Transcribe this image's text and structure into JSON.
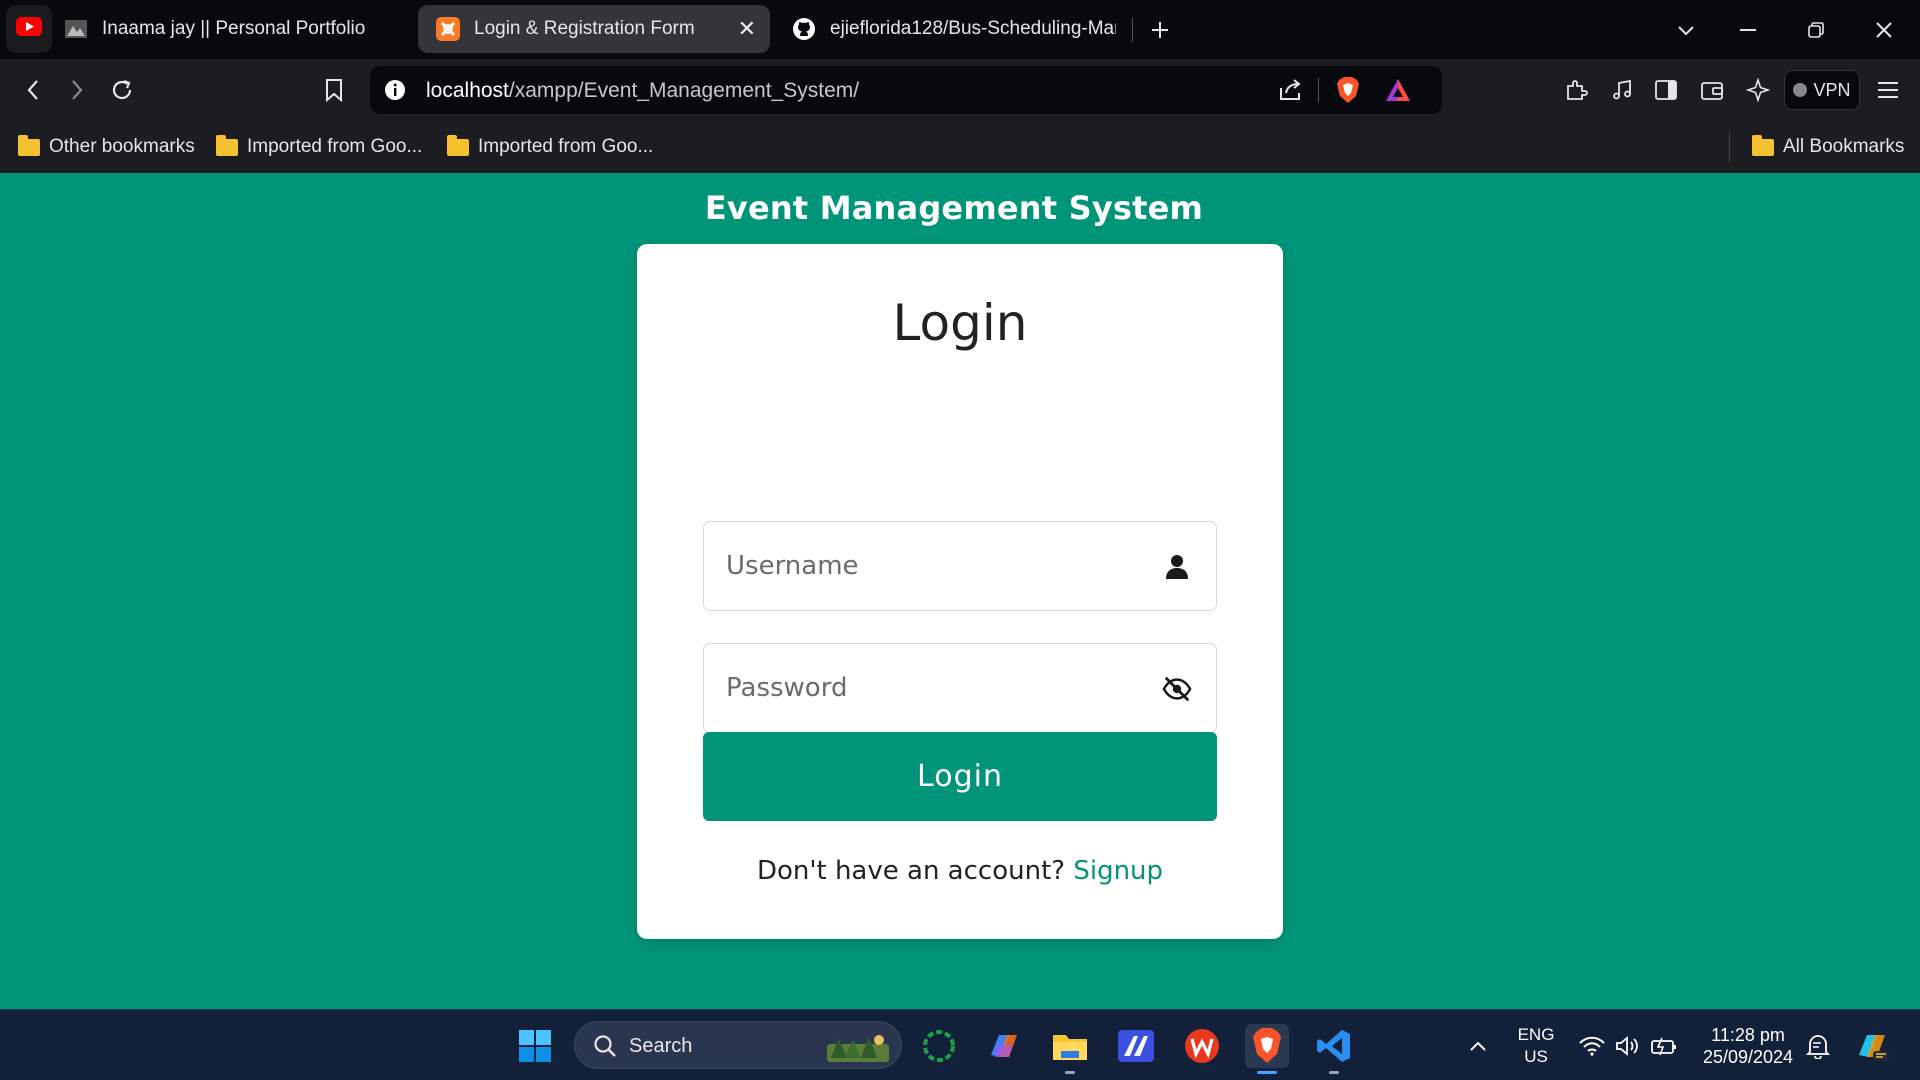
{
  "tabs": [
    {
      "label": "Inaama jay || Personal Portfolio",
      "active": false
    },
    {
      "label": "Login & Registration Form",
      "active": true
    },
    {
      "label": "ejieflorida128/Bus-Scheduling-Man",
      "active": false
    }
  ],
  "address": {
    "host": "localhost",
    "path": "/xampp/Event_Management_System/"
  },
  "toolbar": {
    "vpn_label": "VPN"
  },
  "bookmarks": {
    "items": [
      "Other bookmarks",
      "Imported from Goo...",
      "Imported from Goo..."
    ],
    "all": "All Bookmarks"
  },
  "page": {
    "title": "Event Management System",
    "card_title": "Login",
    "username_placeholder": "Username",
    "password_placeholder": "Password",
    "login_button": "Login",
    "signup_prompt": "Don't have an account?",
    "signup_link": "Signup"
  },
  "taskbar": {
    "search_label": "Search",
    "lang_1": "ENG",
    "lang_2": "US",
    "time": "11:28 pm",
    "date": "25/09/2024"
  },
  "colors": {
    "accent": "#009579",
    "chrome_dark": "#08090c",
    "toolbar": "#1c1d21",
    "taskbar": "#13203a"
  }
}
